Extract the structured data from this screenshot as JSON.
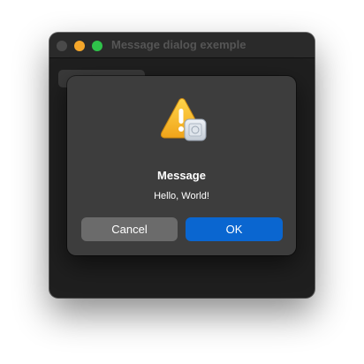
{
  "window": {
    "title": "Message dialog exemple"
  },
  "dialog": {
    "icon": "warning-triangle-icon",
    "title": "Message",
    "message": "Hello, World!",
    "buttons": {
      "cancel": "Cancel",
      "ok": "OK"
    }
  },
  "colors": {
    "accent": "#0a66d0",
    "cancel_button": "#6b6b6b",
    "dialog_bg": "#3d3d3d",
    "window_bg": "#1f1f1f"
  }
}
